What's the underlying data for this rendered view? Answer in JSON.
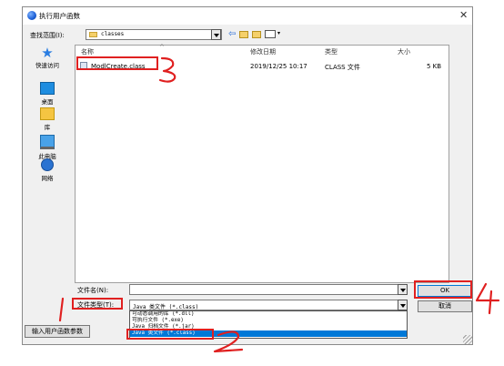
{
  "window": {
    "title": "执行用户函数",
    "close_glyph": "✕"
  },
  "toolbar": {
    "lookin_label": "查找范围(I):",
    "lookin_value": "classes",
    "back_glyph": "⇦",
    "view_caret": "▾"
  },
  "places": [
    {
      "label": "快速访问",
      "icon": "star-icon"
    },
    {
      "label": "桌面",
      "icon": "desktop-icon"
    },
    {
      "label": "库",
      "icon": "library-icon"
    },
    {
      "label": "此电脑",
      "icon": "computer-icon"
    },
    {
      "label": "网络",
      "icon": "network-icon"
    }
  ],
  "filelist": {
    "columns": [
      "名称",
      "修改日期",
      "类型",
      "大小"
    ],
    "sort_glyph": "^",
    "rows": [
      {
        "name": "ModlCreate.class",
        "modified": "2019/12/25 10:17",
        "type": "CLASS 文件",
        "size": "5 KB"
      }
    ]
  },
  "filename": {
    "label": "文件名(N):",
    "value": ""
  },
  "filetype": {
    "label": "文件类型(T):",
    "value": "Java 类文件 (*.class)",
    "options": [
      "可动态调用的库 (*.dll)",
      "可执行文件 (*.exe)",
      "Java 归档文件 (*.jar)",
      "Java 类文件 (*.class)"
    ]
  },
  "buttons": {
    "ok": "OK",
    "cancel": "取消",
    "params": "输入用户函数参数"
  },
  "annotations": {
    "color": "#e02020",
    "n1": "1",
    "n2": "2",
    "n3": "3",
    "n4": "4"
  }
}
